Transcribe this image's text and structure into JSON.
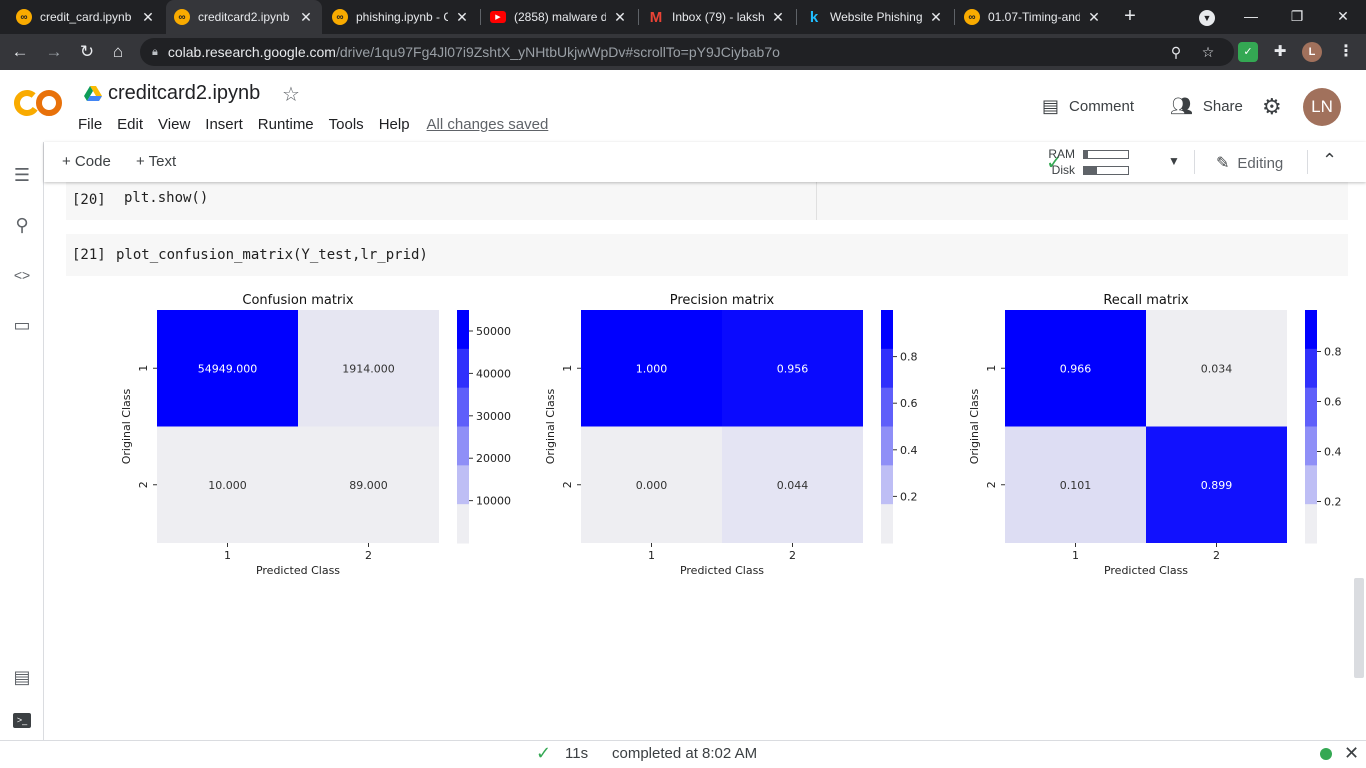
{
  "browser": {
    "tabs": [
      {
        "title": "credit_card.ipynb",
        "icon": "colab-icon",
        "active": false
      },
      {
        "title": "creditcard2.ipynb",
        "icon": "colab-icon",
        "active": true
      },
      {
        "title": "phishing.ipynb - C",
        "icon": "colab-icon",
        "active": false
      },
      {
        "title": "(2858) malware d",
        "icon": "youtube-icon",
        "active": false
      },
      {
        "title": "Inbox (79) - laksh",
        "icon": "gmail-icon",
        "active": false
      },
      {
        "title": "Website Phishing",
        "icon": "kaggle-icon",
        "active": false
      },
      {
        "title": "01.07-Timing-and",
        "icon": "colab-icon",
        "active": false
      }
    ],
    "url_host": "colab.research.google.com",
    "url_path": "/drive/1qu97Fg4Jl07i9ZshtX_yNHtbUkjwWpDv#scrollTo=pY9JCiybab7o",
    "profile_initial": "L"
  },
  "colab": {
    "logo": "CO",
    "doc_title": "creditcard2.ipynb",
    "menu": [
      "File",
      "Edit",
      "View",
      "Insert",
      "Runtime",
      "Tools",
      "Help"
    ],
    "save_status": "All changes saved",
    "comment_label": "Comment",
    "share_label": "Share",
    "avatar_initials": "LN",
    "toolbar": {
      "code_label": "+ Code",
      "text_label": "+ Text",
      "ram_label": "RAM",
      "disk_label": "Disk",
      "ram_fill": 0.08,
      "disk_fill": 0.3,
      "editing_label": "Editing"
    }
  },
  "notebook": {
    "cell20": {
      "prompt": "[20]",
      "code": "plt.show()"
    },
    "cell21": {
      "prompt": "[21]",
      "code": "plot_confusion_matrix(Y_test,lr_prid)"
    }
  },
  "chart_data": [
    {
      "type": "heatmap",
      "title": "Confusion matrix",
      "xlabel": "Predicted Class",
      "ylabel": "Original Class",
      "x_ticks": [
        "1",
        "2"
      ],
      "y_ticks": [
        "1",
        "2"
      ],
      "values": [
        [
          54949,
          1914
        ],
        [
          10,
          89
        ]
      ],
      "labels": [
        [
          "54949.000",
          "1914.000"
        ],
        [
          "10.000",
          "89.000"
        ]
      ],
      "vmin": 10,
      "vmax": 54949,
      "colorbar_ticks": [
        10000,
        20000,
        30000,
        40000,
        50000
      ],
      "colorbar_labels": [
        "10000",
        "20000",
        "30000",
        "40000",
        "50000"
      ],
      "cmap": [
        "#eeeef2",
        "#0000ff"
      ]
    },
    {
      "type": "heatmap",
      "title": "Precision matrix",
      "xlabel": "Predicted Class",
      "ylabel": "Original Class",
      "x_ticks": [
        "1",
        "2"
      ],
      "y_ticks": [
        "1",
        "2"
      ],
      "values": [
        [
          1.0,
          0.956
        ],
        [
          0.0,
          0.044
        ]
      ],
      "labels": [
        [
          "1.000",
          "0.956"
        ],
        [
          "0.000",
          "0.044"
        ]
      ],
      "vmin": 0,
      "vmax": 1.0,
      "colorbar_ticks": [
        0.2,
        0.4,
        0.6,
        0.8
      ],
      "colorbar_labels": [
        "0.2",
        "0.4",
        "0.6",
        "0.8"
      ],
      "cmap": [
        "#eeeef2",
        "#0000ff"
      ]
    },
    {
      "type": "heatmap",
      "title": "Recall matrix",
      "xlabel": "Predicted Class",
      "ylabel": "Original Class",
      "x_ticks": [
        "1",
        "2"
      ],
      "y_ticks": [
        "1",
        "2"
      ],
      "values": [
        [
          0.966,
          0.034
        ],
        [
          0.101,
          0.899
        ]
      ],
      "labels": [
        [
          "0.966",
          "0.034"
        ],
        [
          "0.101",
          "0.899"
        ]
      ],
      "vmin": 0.034,
      "vmax": 0.966,
      "colorbar_ticks": [
        0.2,
        0.4,
        0.6,
        0.8
      ],
      "colorbar_labels": [
        "0.2",
        "0.4",
        "0.6",
        "0.8"
      ],
      "cmap": [
        "#eeeef2",
        "#0000ff"
      ]
    }
  ],
  "status": {
    "elapsed": "11s",
    "message": "completed at 8:02 AM"
  }
}
